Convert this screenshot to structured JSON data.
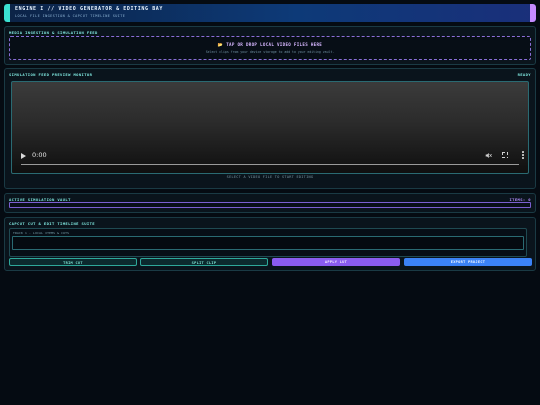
{
  "header": {
    "title": "ENGINE I // VIDEO GENERATOR & EDITING BAY",
    "subtitle": "LOCAL FILE INGESTION & CAPCUT TIMELINE SUITE"
  },
  "ingestion": {
    "title": "MEDIA INGESTION & SIMULATION FEED",
    "drop_icon": "📂",
    "drop_title": "TAP OR DROP LOCAL VIDEO FILES HERE",
    "drop_subtitle": "Select clips from your device storage to add to your editing vault."
  },
  "preview": {
    "title": "SIMULATION FEED PREVIEW MONITOR",
    "status": "READY",
    "time": "0:00",
    "caption": "SELECT A VIDEO FILE TO START EDITING"
  },
  "vault": {
    "title": "ACTIVE SIMULATION VAULT",
    "items_label": "ITEMS: 0"
  },
  "timeline": {
    "title": "CAPCUT CUT & EDIT TIMELINE SUITE",
    "track_label": "TRACK 1 - LOCAL ITEMS & CUTS"
  },
  "buttons": {
    "trim": "TRIM CUT",
    "split": "SPLIT CLIP",
    "apply": "APPLY LUT",
    "export": "EXPORT PROJECT"
  },
  "colors": {
    "accent_teal": "#3be0d0",
    "accent_purple": "#8a5cf0",
    "accent_blue": "#3b82f6",
    "background": "#050b12"
  }
}
